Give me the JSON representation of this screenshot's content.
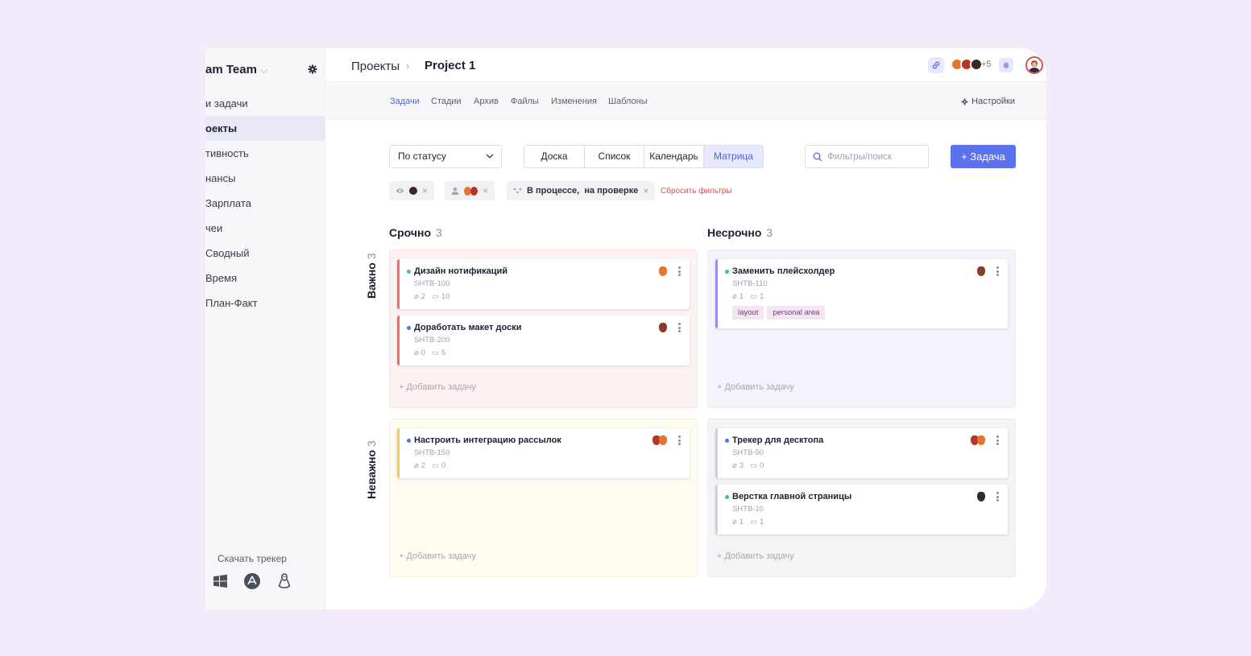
{
  "sidebar": {
    "team_name": "am Team",
    "items": [
      {
        "label": "и задачи",
        "active": false
      },
      {
        "label": "оекты",
        "active": true
      },
      {
        "label": "тивность",
        "active": false
      },
      {
        "label": "нансы",
        "active": false
      },
      {
        "label": "Зарплата",
        "active": false
      },
      {
        "label": "чеи",
        "active": false
      },
      {
        "label": "Сводный",
        "active": false
      },
      {
        "label": "Время",
        "active": false
      },
      {
        "label": "План-Факт",
        "active": false
      }
    ],
    "download_label": "Скачать трекер",
    "os_icons": [
      "windows-icon",
      "appstore-icon",
      "linux-icon"
    ]
  },
  "header": {
    "breadcrumb_root": "Проекты",
    "breadcrumb_sep": "›",
    "project_name": "Project 1",
    "member_extra": "+5"
  },
  "tabs": {
    "items": [
      "Задачи",
      "Стадии",
      "Архив",
      "Файлы",
      "Изменения",
      "Шаблоны"
    ],
    "active": "Задачи",
    "settings_label": "Настройки"
  },
  "toolbar": {
    "group_by": "По статусу",
    "views": [
      "Доска",
      "Список",
      "Календарь",
      "Матрица"
    ],
    "active_view": "Матрица",
    "search_placeholder": "Фильтры/поиск",
    "add_task_label": "+ Задача"
  },
  "filters": {
    "status_chip": "В процессе,  на проверке",
    "reset_label": "Сбросить фильтры"
  },
  "matrix": {
    "columns": [
      {
        "title": "Срочно",
        "count": "3"
      },
      {
        "title": "Несрочно",
        "count": "3"
      }
    ],
    "rows": [
      {
        "title": "Важно",
        "count": "3"
      },
      {
        "title": "Неважно",
        "count": "3"
      }
    ],
    "add_task_label": "+ Добавить задачу",
    "quadrants": {
      "urgent_important": [
        {
          "title": "Дизайн нотификаций",
          "code": "SHTB-100",
          "attachments": "2",
          "comments": "10",
          "dot": "#3cc3a0"
        },
        {
          "title": "Доработать макет доски",
          "code": "SHTB-200",
          "attachments": "0",
          "comments": "5",
          "dot": "#5b71ee"
        }
      ],
      "nonurgent_important": [
        {
          "title": "Заменить плейсхолдер",
          "code": "SHTB-110",
          "attachments": "1",
          "comments": "1",
          "dot": "#3cc3a0",
          "tags": [
            "layout",
            "personal area"
          ]
        }
      ],
      "urgent_unimportant": [
        {
          "title": "Настроить интеграцию рассылок",
          "code": "SHTB-150",
          "attachments": "2",
          "comments": "0",
          "dot": "#5b71ee"
        }
      ],
      "nonurgent_unimportant": [
        {
          "title": "Трекер для десктопа",
          "code": "SHTB-50",
          "attachments": "3",
          "comments": "0",
          "dot": "#5b71ee"
        },
        {
          "title": "Верстка главной страницы",
          "code": "SHTB-10",
          "attachments": "1",
          "comments": "1",
          "dot": "#3cc3a0"
        }
      ]
    }
  },
  "colors": {
    "accent": "#5b71ee",
    "urgent_important_bar": "#ef6b6b",
    "nonurgent_important_bar": "#9f8cf0",
    "urgent_unimportant_bar": "#f5cd4e",
    "nonurgent_unimportant_bar": "#d0d0d6",
    "reset_red": "#e14b4b"
  }
}
